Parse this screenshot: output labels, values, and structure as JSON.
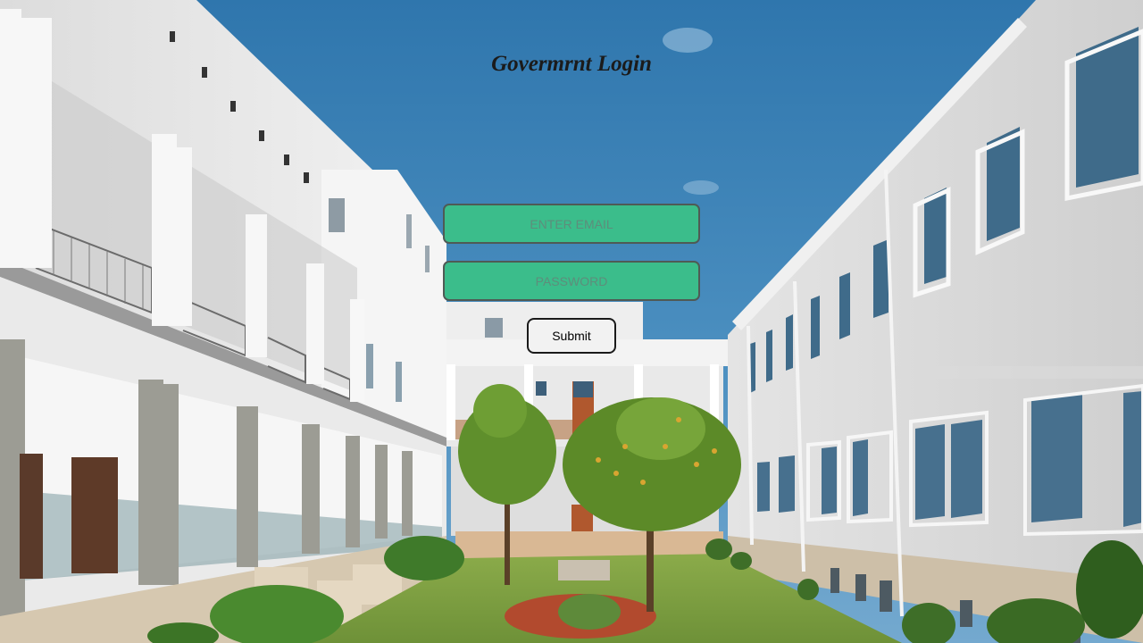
{
  "page": {
    "title": "Govermrnt Login"
  },
  "form": {
    "email_placeholder": "ENTER EMAIL",
    "email_value": "",
    "password_placeholder": "PASSWORD",
    "password_value": "",
    "submit_label": "Submit"
  },
  "colors": {
    "sky": "#3a7fb3",
    "field_bg": "#3bbd8b",
    "field_border": "#4f5a55",
    "button_bg": "#f2f2f2",
    "building": "#eaeaea",
    "grass": "#7da043"
  }
}
